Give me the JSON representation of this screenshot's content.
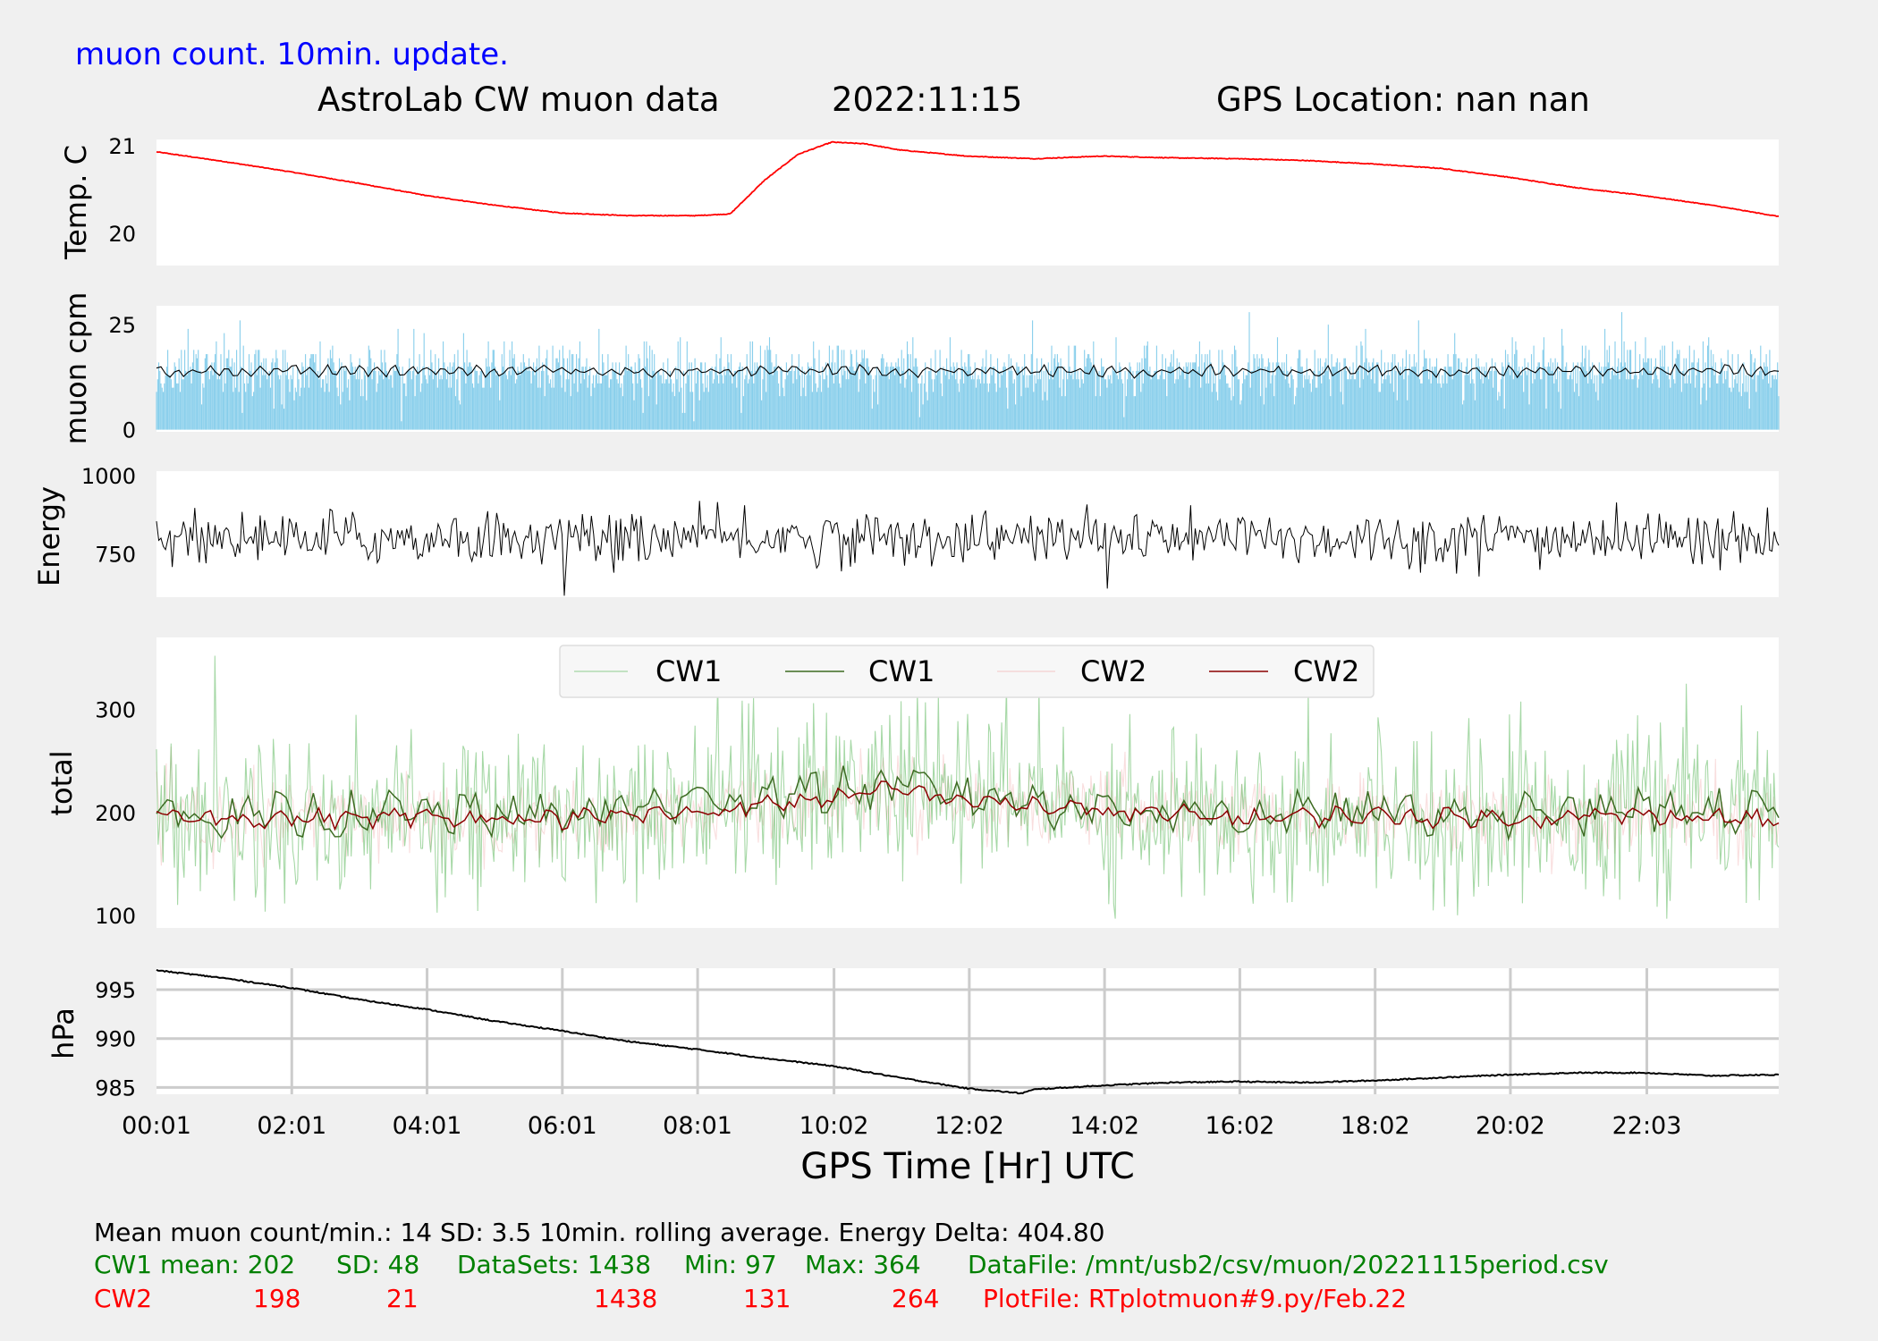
{
  "header": {
    "update_note": "muon count.  10min. update.",
    "title_left": "AstroLab CW muon data",
    "title_date": "2022:11:15",
    "title_gps": "GPS Location: nan   nan"
  },
  "colors": {
    "background": "#f0f0f0",
    "panel": "#ffffff",
    "temp": "#ff0000",
    "muon_bars": "#87ceeb",
    "muon_avg": "#000000",
    "energy": "#000000",
    "cw1_raw": "#5cb85c",
    "cw1_avg": "#3d6b22",
    "cw2_raw": "#f4c2c2",
    "cw2_avg": "#8b0000",
    "hpa": "#000000",
    "grid": "#cccccc",
    "blue_text": "#0000ff",
    "green_text": "#008000",
    "red_text": "#ff0000"
  },
  "chart_data": [
    {
      "id": "temp",
      "type": "line",
      "ylabel": "Temp. C",
      "ylim": [
        19.63,
        21.07
      ],
      "yticks": [
        20,
        21
      ],
      "grid": false,
      "x_unit": "hours UTC",
      "series": [
        {
          "x": [
            0,
            1,
            2,
            3,
            4,
            5,
            6,
            7,
            8,
            8.5,
            9,
            9.5,
            10,
            10.5,
            11,
            12,
            13,
            14,
            15,
            16,
            17,
            18,
            19,
            20,
            21,
            22,
            23,
            24
          ],
          "values": [
            20.93,
            20.82,
            20.7,
            20.57,
            20.43,
            20.32,
            20.23,
            20.2,
            20.2,
            20.22,
            20.6,
            20.9,
            21.04,
            21.02,
            20.95,
            20.88,
            20.85,
            20.88,
            20.86,
            20.85,
            20.83,
            20.79,
            20.74,
            20.64,
            20.52,
            20.43,
            20.32,
            20.19
          ]
        }
      ]
    },
    {
      "id": "muon",
      "type": "bar",
      "ylabel": "muon cpm",
      "ylim": [
        -0.5,
        29.5
      ],
      "yticks": [
        0,
        25
      ],
      "grid": false,
      "raw_mean": 14,
      "raw_sd": 3.5,
      "avg_line": {
        "x": [
          0,
          1,
          2,
          3,
          4,
          5,
          6,
          7,
          8,
          9,
          10,
          11,
          12,
          13,
          14,
          15,
          16,
          17,
          18,
          19,
          20,
          21,
          22,
          23,
          24
        ],
        "values": [
          14,
          13.6,
          14.2,
          13.9,
          14.0,
          13.8,
          14.1,
          13.7,
          13.9,
          14.0,
          14.2,
          13.9,
          14.1,
          14.0,
          13.8,
          13.9,
          14.2,
          13.8,
          14.0,
          13.7,
          14.0,
          14.1,
          13.9,
          14.3,
          13.9
        ]
      }
    },
    {
      "id": "energy",
      "type": "line",
      "ylabel": "Energy",
      "ylim": [
        610,
        1015
      ],
      "yticks": [
        750,
        1000
      ],
      "grid": false,
      "baseline": 800,
      "spread": 42
    },
    {
      "id": "total",
      "type": "line",
      "ylabel": "total",
      "ylim": [
        88,
        370
      ],
      "yticks": [
        100,
        200,
        300
      ],
      "grid": false,
      "legend": [
        "CW1",
        "CW1",
        "CW2",
        "CW2"
      ],
      "legend_position": "upper-center",
      "series": [
        {
          "name": "CW1",
          "style": "raw",
          "mean": 202,
          "sd": 48,
          "min": 97,
          "max": 364
        },
        {
          "name": "CW1",
          "style": "rolling-avg",
          "x": [
            0,
            2,
            4,
            6,
            8,
            10,
            11,
            12,
            14,
            16,
            18,
            20,
            22,
            24
          ],
          "values": [
            200,
            195,
            200,
            197,
            212,
            222,
            225,
            217,
            205,
            197,
            200,
            196,
            203,
            200
          ]
        },
        {
          "name": "CW2",
          "style": "raw",
          "mean": 198,
          "sd": 21,
          "min": 131,
          "max": 264
        },
        {
          "name": "CW2",
          "style": "rolling-avg",
          "x": [
            0,
            2,
            4,
            6,
            8,
            10,
            11,
            12,
            14,
            16,
            18,
            20,
            22,
            24
          ],
          "values": [
            196,
            194,
            196,
            194,
            200,
            215,
            222,
            212,
            201,
            195,
            197,
            194,
            198,
            193
          ]
        }
      ]
    },
    {
      "id": "hpa",
      "type": "line",
      "ylabel": "hPa",
      "ylim": [
        984.3,
        997.2
      ],
      "yticks": [
        985,
        990,
        995
      ],
      "grid": true,
      "series": [
        {
          "x": [
            0,
            1,
            2,
            3,
            4,
            5,
            6,
            7,
            8,
            9,
            10,
            11,
            12,
            12.8,
            13,
            14,
            15,
            16,
            17,
            18,
            19,
            20,
            21,
            22,
            23,
            24
          ],
          "values": [
            997.0,
            996.2,
            995.2,
            994.0,
            993.0,
            991.8,
            990.8,
            989.7,
            988.9,
            988.0,
            987.2,
            986.0,
            984.9,
            984.4,
            984.8,
            985.2,
            985.5,
            985.6,
            985.5,
            985.7,
            986.0,
            986.3,
            986.5,
            986.5,
            986.2,
            986.3
          ]
        }
      ]
    }
  ],
  "xaxis": {
    "label": "GPS Time  [Hr] UTC",
    "xlim": [
      0.0167,
      24
    ],
    "ticks": [
      {
        "hour": 0.0167,
        "label": "00:01"
      },
      {
        "hour": 2.0167,
        "label": "02:01"
      },
      {
        "hour": 4.0167,
        "label": "04:01"
      },
      {
        "hour": 6.0167,
        "label": "06:01"
      },
      {
        "hour": 8.0167,
        "label": "08:01"
      },
      {
        "hour": 10.033,
        "label": "10:02"
      },
      {
        "hour": 12.033,
        "label": "12:02"
      },
      {
        "hour": 14.033,
        "label": "14:02"
      },
      {
        "hour": 16.033,
        "label": "16:02"
      },
      {
        "hour": 18.033,
        "label": "18:02"
      },
      {
        "hour": 20.033,
        "label": "20:02"
      },
      {
        "hour": 22.05,
        "label": "22:03"
      }
    ]
  },
  "footer": {
    "line1": "Mean muon count/min.: 14  SD: 3.5   10min. rolling average.    Energy Delta:  404.80",
    "cw1": {
      "label": "CW1 mean: 202",
      "sd": "SD: 48",
      "datasets": "DataSets: 1438",
      "min": "Min: 97",
      "max": "Max: 364",
      "file": "DataFile: /mnt/usb2/csv/muon/20221115period.csv"
    },
    "cw2": {
      "label": "CW2",
      "mean": "198",
      "sd": "21",
      "datasets": "1438",
      "min": "131",
      "max": "264",
      "file": "PlotFile: RTplotmuon#9.py/Feb.22"
    }
  }
}
